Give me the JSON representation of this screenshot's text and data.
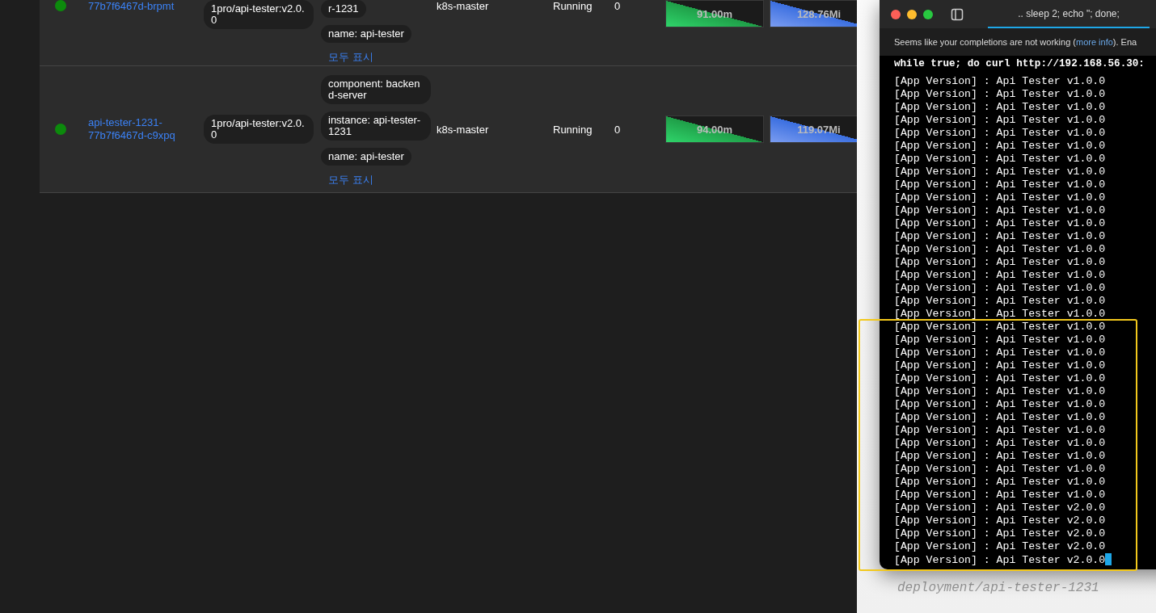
{
  "pods": [
    {
      "name": "77b7f6467d-brpmt",
      "image": "1pro/api-tester:v2.0.0",
      "labels": [
        "r-1231",
        "name: api-tester"
      ],
      "show_all": "모두 표시",
      "node": "k8s-master",
      "status": "Running",
      "restarts": "0",
      "cpu": "91.00m",
      "memory": "128.76Mi"
    },
    {
      "name": "api-tester-1231-77b7f6467d-c9xpq",
      "image": "1pro/api-tester:v2.0.0",
      "labels": [
        "component: backend-server",
        "instance: api-tester-1231",
        "name: api-tester"
      ],
      "show_all": "모두 표시",
      "node": "k8s-master",
      "status": "Running",
      "restarts": "0",
      "cpu": "94.00m",
      "memory": "119.07Mi"
    }
  ],
  "terminal": {
    "tab_title": ".. sleep 2; echo \"; done;",
    "notice": {
      "text": "Seems like your completions are not working (",
      "link": "more info",
      "after": "). Ena"
    },
    "command": "while true; do curl http://192.168.56.30:",
    "output": [
      "[App Version] : Api Tester v1.0.0",
      "[App Version] : Api Tester v1.0.0",
      "[App Version] : Api Tester v1.0.0",
      "[App Version] : Api Tester v1.0.0",
      "[App Version] : Api Tester v1.0.0",
      "[App Version] : Api Tester v1.0.0",
      "[App Version] : Api Tester v1.0.0",
      "[App Version] : Api Tester v1.0.0",
      "[App Version] : Api Tester v1.0.0",
      "[App Version] : Api Tester v1.0.0",
      "[App Version] : Api Tester v1.0.0",
      "[App Version] : Api Tester v1.0.0",
      "[App Version] : Api Tester v1.0.0",
      "[App Version] : Api Tester v1.0.0",
      "[App Version] : Api Tester v1.0.0",
      "[App Version] : Api Tester v1.0.0",
      "[App Version] : Api Tester v1.0.0",
      "[App Version] : Api Tester v1.0.0",
      "[App Version] : Api Tester v1.0.0",
      "[App Version] : Api Tester v1.0.0",
      "[App Version] : Api Tester v1.0.0",
      "[App Version] : Api Tester v1.0.0",
      "[App Version] : Api Tester v1.0.0",
      "[App Version] : Api Tester v1.0.0",
      "[App Version] : Api Tester v1.0.0",
      "[App Version] : Api Tester v1.0.0",
      "[App Version] : Api Tester v1.0.0",
      "[App Version] : Api Tester v1.0.0",
      "[App Version] : Api Tester v1.0.0",
      "[App Version] : Api Tester v1.0.0",
      "[App Version] : Api Tester v1.0.0",
      "[App Version] : Api Tester v1.0.0",
      "[App Version] : Api Tester v1.0.0",
      "[App Version] : Api Tester v2.0.0",
      "[App Version] : Api Tester v2.0.0",
      "[App Version] : Api Tester v2.0.0",
      "[App Version] : Api Tester v2.0.0",
      "[App Version] : Api Tester v2.0.0"
    ]
  },
  "background_text": "deployment/api-tester-1231"
}
